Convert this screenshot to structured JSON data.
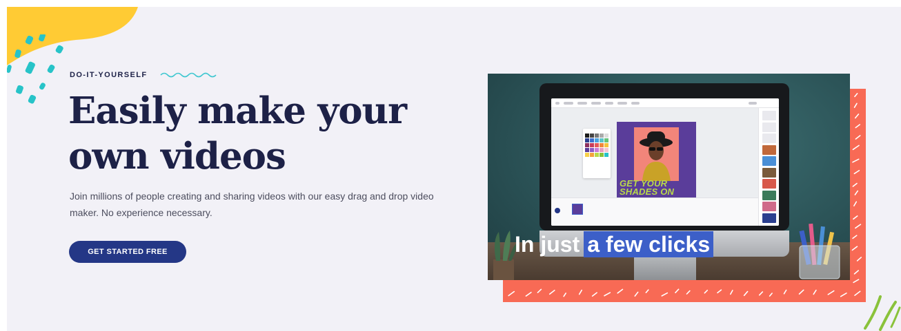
{
  "hero": {
    "eyebrow": "DO-IT-YOURSELF",
    "headline": "Easily make your own videos",
    "subcopy": "Join millions of people creating and sharing videos with our easy drag and drop video maker. No experience necessary.",
    "cta_label": "GET STARTED FREE"
  },
  "video": {
    "caption_plain": "In just",
    "caption_highlight": "a few clicks",
    "poster_text_line1": "GET YOUR",
    "poster_text_line2": "SHADES ON"
  },
  "colors": {
    "page_background": "#f2f1f7",
    "headline": "#1d2147",
    "cta_background": "#243786",
    "squiggle": "#3ec7d0",
    "accent_yellow": "#ffcb34",
    "accent_teal": "#27c3c8",
    "accent_coral": "#f86a55",
    "accent_green": "#8ac23b",
    "caption_highlight": "#3c5fc8"
  },
  "icons": [
    "squiggle-icon"
  ]
}
